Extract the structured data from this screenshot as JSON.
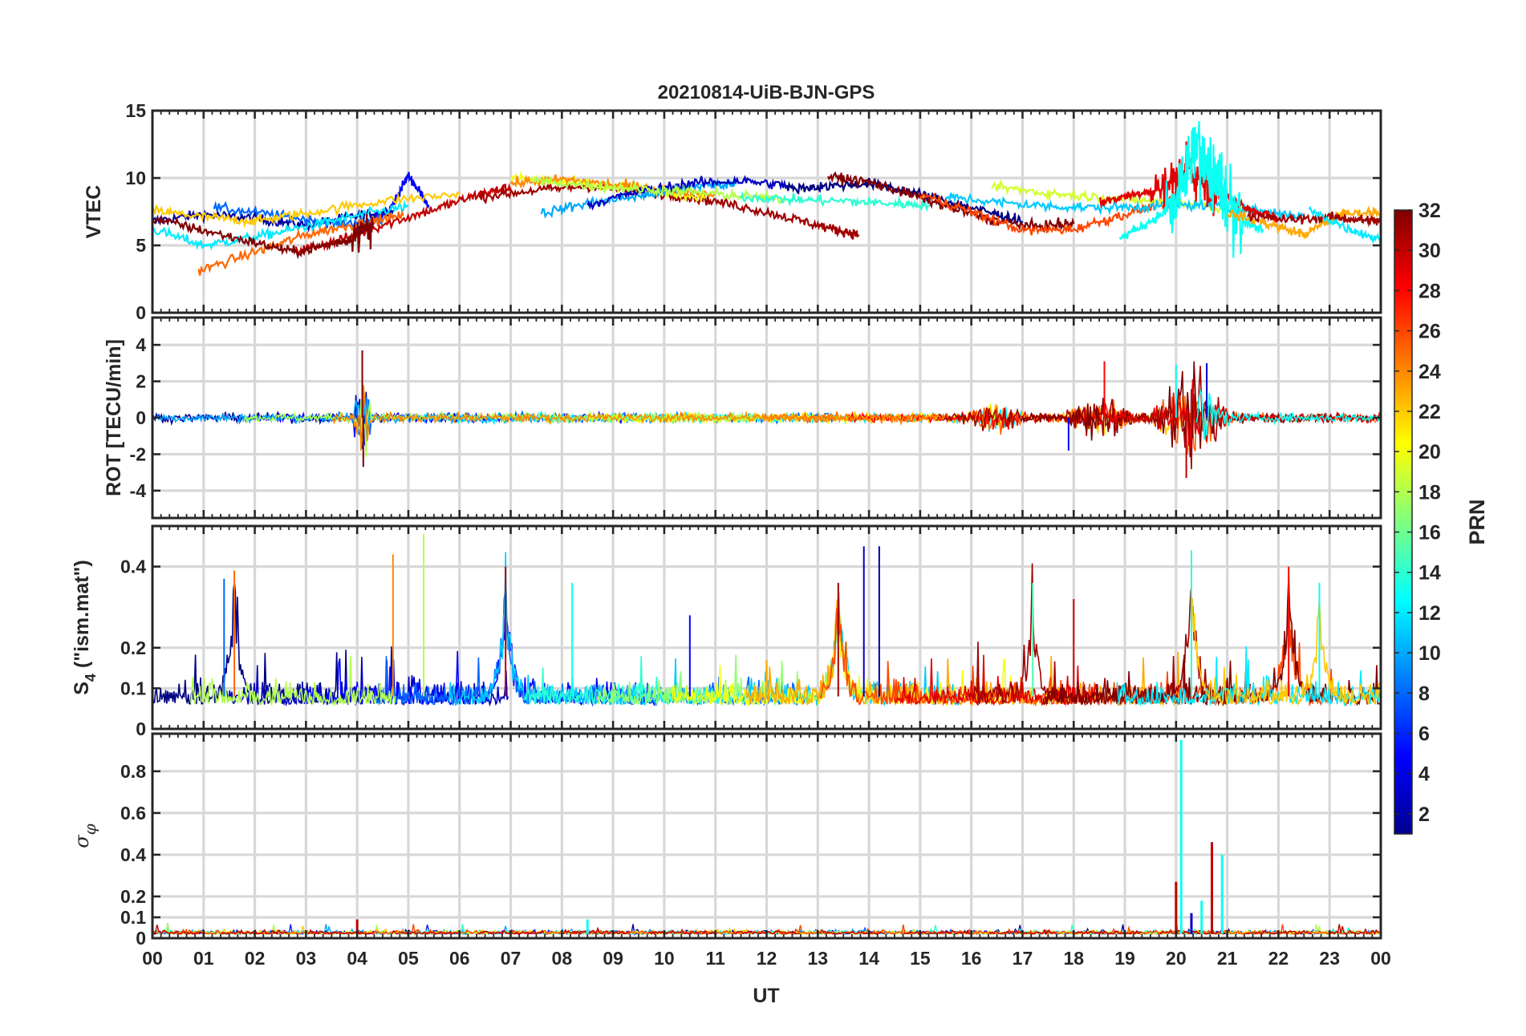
{
  "figure": {
    "title": "20210814-UiB-BJN-GPS",
    "xlabel": "UT"
  },
  "chart_data": [
    {
      "type": "line",
      "panel": "vtec",
      "ylabel": "VTEC",
      "ylim": [
        0,
        15
      ],
      "yticks": [
        0,
        5,
        10,
        15
      ],
      "grid": true,
      "x_unit": "hours UT",
      "xlim": [
        0,
        24
      ],
      "series_note": "one trace per GPS satellite, color = PRN",
      "series": [
        {
          "prn": 2,
          "x": [
            0.0,
            1.0,
            2.0,
            3.0,
            4.0,
            4.7
          ],
          "y": [
            6.8,
            7.3,
            7.0,
            6.5,
            7.2,
            7.6
          ]
        },
        {
          "prn": 5,
          "x": [
            4.0,
            4.6,
            5.0,
            5.4
          ],
          "y": [
            6.2,
            7.4,
            10.2,
            8.0
          ]
        },
        {
          "prn": 8,
          "x": [
            1.2,
            2.5,
            3.6,
            4.5
          ],
          "y": [
            7.8,
            7.2,
            6.6,
            6.9
          ]
        },
        {
          "prn": 12,
          "x": [
            0.0,
            1.0,
            2.0,
            3.0,
            4.0,
            5.0
          ],
          "y": [
            6.2,
            5.0,
            5.6,
            6.4,
            7.2,
            7.9
          ]
        },
        {
          "prn": 22,
          "x": [
            0.0,
            1.0,
            2.0,
            3.0,
            4.5,
            6.0
          ],
          "y": [
            7.6,
            7.1,
            6.8,
            7.4,
            8.3,
            8.8
          ]
        },
        {
          "prn": 25,
          "x": [
            0.9,
            2.0,
            3.0,
            4.0,
            4.9
          ],
          "y": [
            3.1,
            4.5,
            5.8,
            6.6,
            7.2
          ]
        },
        {
          "prn": 30,
          "x": [
            2.8,
            3.6,
            4.5,
            5.6,
            6.4,
            7.0
          ],
          "y": [
            4.6,
            5.3,
            6.5,
            7.8,
            8.8,
            9.3
          ]
        },
        {
          "prn": 32,
          "x": [
            0.0,
            1.0,
            2.0,
            2.8,
            3.6,
            4.0,
            4.3
          ],
          "y": [
            7.0,
            6.1,
            5.2,
            4.5,
            5.2,
            5.6,
            6.4
          ]
        },
        {
          "prn": 31,
          "x": [
            6.4,
            7.5,
            8.5,
            9.5,
            10.5,
            11.5,
            12.5,
            13.3,
            13.8
          ],
          "y": [
            8.6,
            9.1,
            9.4,
            9.0,
            8.6,
            7.9,
            7.0,
            6.2,
            5.8
          ]
        },
        {
          "prn": 20,
          "x": [
            7.0,
            8.0,
            9.0,
            10.0,
            10.8
          ],
          "y": [
            10.0,
            9.7,
            9.3,
            8.9,
            8.6
          ]
        },
        {
          "prn": 24,
          "x": [
            7.0,
            8.0,
            9.0,
            10.0,
            11.0
          ],
          "y": [
            9.6,
            9.9,
            9.5,
            9.2,
            8.8
          ]
        },
        {
          "prn": 10,
          "x": [
            7.6,
            8.6,
            9.6,
            10.6,
            11.4
          ],
          "y": [
            7.4,
            8.2,
            8.7,
            9.4,
            9.6
          ]
        },
        {
          "prn": 3,
          "x": [
            8.5,
            9.5,
            10.5,
            11.5,
            12.5
          ],
          "y": [
            8.0,
            9.0,
            9.6,
            9.8,
            9.4
          ]
        },
        {
          "prn": 18,
          "x": [
            7.4,
            8.4,
            9.4,
            10.4,
            11.4,
            12.4
          ],
          "y": [
            9.8,
            9.5,
            9.2,
            9.0,
            8.7,
            8.4
          ]
        },
        {
          "prn": 14,
          "x": [
            11.5,
            12.5,
            13.5,
            14.5,
            15.2
          ],
          "y": [
            8.6,
            8.4,
            8.3,
            8.1,
            8.0
          ]
        },
        {
          "prn": 1,
          "x": [
            12.4,
            13.2,
            14.0,
            14.8,
            15.6,
            16.4,
            17.0
          ],
          "y": [
            9.2,
            9.4,
            9.6,
            9.0,
            8.2,
            7.4,
            6.8
          ]
        },
        {
          "prn": 32,
          "x": [
            13.2,
            14.0,
            14.8,
            15.6,
            16.4,
            17.2,
            18.0
          ],
          "y": [
            10.1,
            9.7,
            8.8,
            7.8,
            6.9,
            6.4,
            6.6
          ]
        },
        {
          "prn": 26,
          "x": [
            15.0,
            16.0,
            17.0,
            18.0,
            19.0,
            20.0
          ],
          "y": [
            8.8,
            7.5,
            6.1,
            6.2,
            7.3,
            8.4
          ]
        },
        {
          "prn": 19,
          "x": [
            16.4,
            17.4,
            18.4,
            19.4,
            20.4,
            21.4
          ],
          "y": [
            9.4,
            8.9,
            8.6,
            8.3,
            8.0,
            7.6
          ]
        },
        {
          "prn": 11,
          "x": [
            15.5,
            16.5,
            17.5,
            18.5,
            19.5,
            20.5,
            21.5,
            22.5
          ],
          "y": [
            8.6,
            8.2,
            7.9,
            7.8,
            7.9,
            8.0,
            7.6,
            7.2
          ]
        },
        {
          "prn": 29,
          "x": [
            18.5,
            19.2,
            19.8,
            20.2,
            20.6,
            21.0,
            21.5,
            22.0
          ],
          "y": [
            8.2,
            8.8,
            9.4,
            10.8,
            9.6,
            8.6,
            7.6,
            7.0
          ]
        },
        {
          "prn": 13,
          "x": [
            18.9,
            19.5,
            20.0,
            20.4,
            20.8,
            21.2,
            21.7
          ],
          "y": [
            5.5,
            6.8,
            8.0,
            12.5,
            9.5,
            7.0,
            6.2
          ]
        },
        {
          "prn": 23,
          "x": [
            21.0,
            21.8,
            22.5,
            23.2,
            24.0
          ],
          "y": [
            7.4,
            6.6,
            5.8,
            7.3,
            7.5
          ]
        },
        {
          "prn": 31,
          "x": [
            21.4,
            22.2,
            23.0,
            23.6,
            24.0
          ],
          "y": [
            7.2,
            6.9,
            7.1,
            6.9,
            6.8
          ]
        },
        {
          "prn": 12,
          "x": [
            22.6,
            23.4,
            24.0
          ],
          "y": [
            7.6,
            6.2,
            5.4
          ]
        }
      ]
    },
    {
      "type": "line",
      "panel": "rot",
      "ylabel": "ROT [TECU/min]",
      "ylim": [
        -5.5,
        5.5
      ],
      "yticks": [
        -4,
        -2,
        0,
        2,
        4
      ],
      "grid": true,
      "xlim": [
        0,
        24
      ],
      "bursts": [
        {
          "center": 4.1,
          "width": 0.4,
          "amplitude": 3.6
        },
        {
          "center": 20.3,
          "width": 1.6,
          "amplitude": 3.2
        },
        {
          "center": 18.5,
          "width": 1.4,
          "amplitude": 1.6
        },
        {
          "center": 16.5,
          "width": 1.2,
          "amplitude": 1.0
        }
      ],
      "range_observed": [
        -3.3,
        3.7
      ]
    },
    {
      "type": "line",
      "panel": "s4",
      "ylabel": "S₄ (\"ism.mat\")",
      "ylim": [
        0,
        0.5
      ],
      "yticks": [
        0,
        0.1,
        0.2,
        0.4
      ],
      "grid": true,
      "xlim": [
        0,
        24
      ],
      "baseline": 0.06,
      "peaks": [
        {
          "x": 1.4,
          "y": 0.37
        },
        {
          "x": 1.6,
          "y": 0.39
        },
        {
          "x": 4.7,
          "y": 0.43
        },
        {
          "x": 5.3,
          "y": 0.48
        },
        {
          "x": 6.9,
          "y": 0.4
        },
        {
          "x": 8.2,
          "y": 0.36
        },
        {
          "x": 10.5,
          "y": 0.28
        },
        {
          "x": 13.4,
          "y": 0.36
        },
        {
          "x": 13.9,
          "y": 0.45
        },
        {
          "x": 14.2,
          "y": 0.45
        },
        {
          "x": 17.2,
          "y": 0.36
        },
        {
          "x": 18.0,
          "y": 0.32
        },
        {
          "x": 20.3,
          "y": 0.44
        },
        {
          "x": 22.2,
          "y": 0.4
        },
        {
          "x": 22.8,
          "y": 0.36
        }
      ]
    },
    {
      "type": "line",
      "panel": "sigma_phi",
      "ylabel": "σ_φ",
      "ylim": [
        0,
        0.98
      ],
      "yticks": [
        0,
        0.1,
        0.2,
        0.4,
        0.6,
        0.8
      ],
      "grid": true,
      "xlim": [
        0,
        24
      ],
      "baseline": 0.02,
      "peaks": [
        {
          "x": 4.0,
          "y": 0.09
        },
        {
          "x": 8.5,
          "y": 0.09
        },
        {
          "x": 20.0,
          "y": 0.27
        },
        {
          "x": 20.1,
          "y": 0.95
        },
        {
          "x": 20.3,
          "y": 0.12
        },
        {
          "x": 20.5,
          "y": 0.18
        },
        {
          "x": 20.7,
          "y": 0.46
        },
        {
          "x": 20.9,
          "y": 0.4
        }
      ]
    }
  ],
  "xaxis": {
    "ticklabels": [
      "00",
      "01",
      "02",
      "03",
      "04",
      "05",
      "06",
      "07",
      "08",
      "09",
      "10",
      "11",
      "12",
      "13",
      "14",
      "15",
      "16",
      "17",
      "18",
      "19",
      "20",
      "21",
      "22",
      "23",
      "00"
    ]
  },
  "colorbar": {
    "label": "PRN",
    "colormap": "jet",
    "range": [
      1,
      32
    ],
    "ticks": [
      "2",
      "4",
      "6",
      "8",
      "10",
      "12",
      "14",
      "16",
      "18",
      "20",
      "22",
      "24",
      "26",
      "28",
      "30",
      "32"
    ],
    "tick_values": [
      2,
      4,
      6,
      8,
      10,
      12,
      14,
      16,
      18,
      20,
      22,
      24,
      26,
      28,
      30,
      32
    ]
  },
  "colors": {
    "axis": "#262626",
    "grid": "#d8d8d8",
    "background": "#ffffff"
  }
}
